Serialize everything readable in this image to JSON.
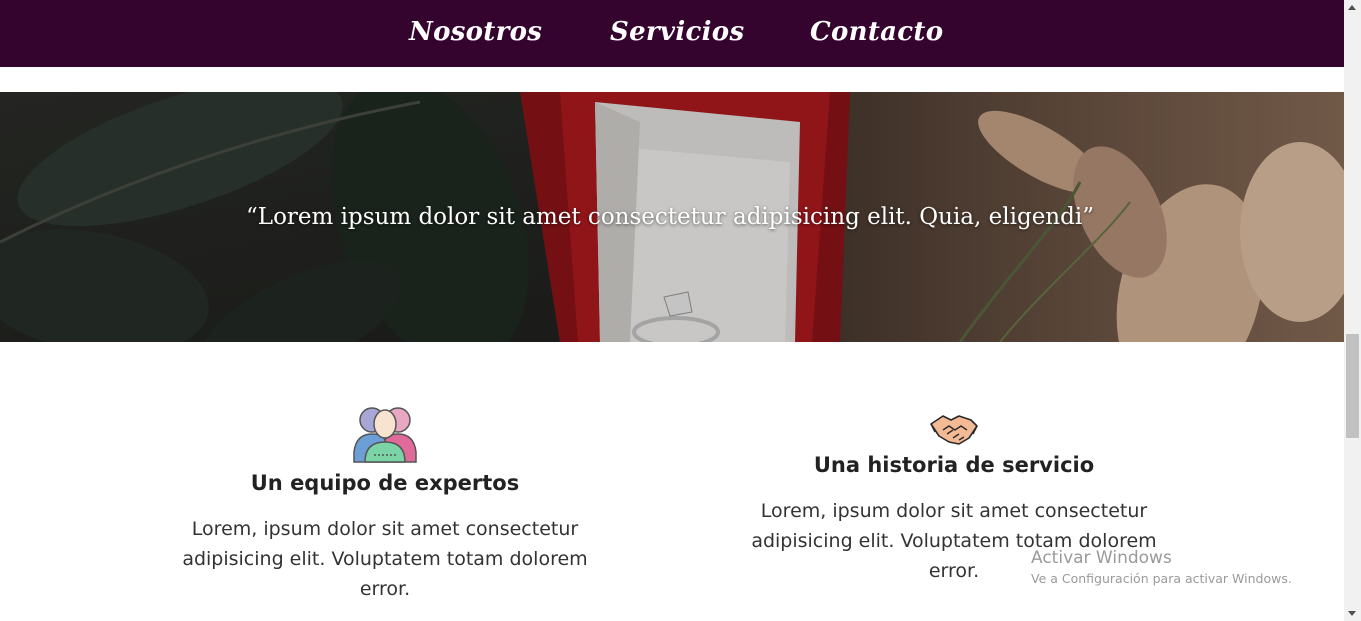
{
  "nav": {
    "items": [
      {
        "label": "Nosotros"
      },
      {
        "label": "Servicios"
      },
      {
        "label": "Contacto"
      }
    ]
  },
  "hero": {
    "quote": "“Lorem ipsum dolor sit amet consectetur adipisicing elit. Quia, eligendi”"
  },
  "features": [
    {
      "icon": "people-group-icon",
      "title": "Un equipo de expertos",
      "lines": [
        "Lorem, ipsum dolor sit amet consectetur",
        "adipisicing elit. Voluptatem totam dolorem",
        "error."
      ]
    },
    {
      "icon": "handshake-icon",
      "title": "Una historia de servicio",
      "lines": [
        "Lorem, ipsum dolor sit amet consectetur",
        "adipisicing elit. Voluptatem totam dolorem",
        "error."
      ]
    }
  ],
  "watermark": {
    "title": "Activar Windows",
    "subtitle": "Ve a Configuración para activar Windows."
  },
  "colors": {
    "nav_bg": "#34032e",
    "text_dark": "#222222"
  }
}
